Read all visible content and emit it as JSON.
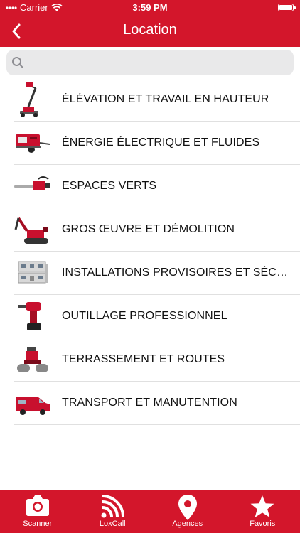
{
  "status_bar": {
    "carrier": "Carrier",
    "time": "3:59 PM"
  },
  "nav": {
    "title": "Location"
  },
  "search": {
    "placeholder": ""
  },
  "categories": [
    {
      "label": "ÉLÉVATION ET TRAVAIL EN HAUTEUR",
      "icon": "boom-lift-image"
    },
    {
      "label": "ÉNERGIE ÉLECTRIQUE ET FLUIDES",
      "icon": "generator-image"
    },
    {
      "label": "ESPACES VERTS",
      "icon": "chainsaw-image"
    },
    {
      "label": "GROS ŒUVRE ET DÉMOLITION",
      "icon": "demolition-robot-image"
    },
    {
      "label": "INSTALLATIONS PROVISOIRES ET SÉCURITÉ",
      "icon": "site-cabin-image"
    },
    {
      "label": "OUTILLAGE PROFESSIONNEL",
      "icon": "drill-image"
    },
    {
      "label": "TERRASSEMENT ET ROUTES",
      "icon": "road-roller-image"
    },
    {
      "label": "TRANSPORT ET MANUTENTION",
      "icon": "van-image"
    }
  ],
  "tabs": [
    {
      "label": "Scanner",
      "icon": "camera-icon"
    },
    {
      "label": "LoxCall",
      "icon": "broadcast-icon"
    },
    {
      "label": "Agences",
      "icon": "location-pin-icon"
    },
    {
      "label": "Favoris",
      "icon": "star-icon"
    }
  ],
  "colors": {
    "brand_red": "#d3162b",
    "search_bg": "#e9e9ea",
    "separator": "#e0e0e0"
  }
}
